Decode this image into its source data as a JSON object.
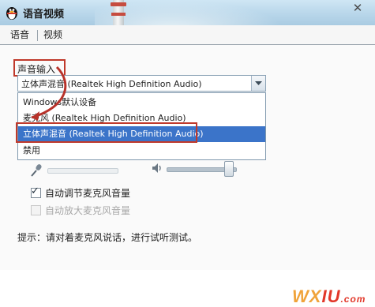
{
  "window": {
    "title": "语音视频",
    "close_glyph": "✕"
  },
  "tabs": [
    {
      "label": "语音",
      "active": true
    },
    {
      "label": "视频",
      "active": false
    }
  ],
  "voice_input": {
    "group_label": "声音输入",
    "selected": "立体声混音 (Realtek High Definition Audio)",
    "options": [
      "Windows默认设备",
      "麦克风 (Realtek High Definition Audio)",
      "立体声混音 (Realtek High Definition Audio)",
      "禁用"
    ],
    "highlighted_index": 2
  },
  "sliders": {
    "mic_icon": "microphone-icon",
    "speaker_icon": "speaker-icon",
    "speaker_volume_fraction": 0.9
  },
  "checkboxes": [
    {
      "label": "自动调节麦克风音量",
      "checked": true,
      "enabled": true
    },
    {
      "label": "自动放大麦克风音量",
      "checked": false,
      "enabled": false
    }
  ],
  "tip": "提示：请对着麦克风说话，进行试听测试。",
  "watermark": {
    "part1": "WX",
    "part2": "IU",
    "part3": ".com"
  },
  "colors": {
    "highlight_red": "#c0392b",
    "selection_blue": "#3b74c9"
  }
}
